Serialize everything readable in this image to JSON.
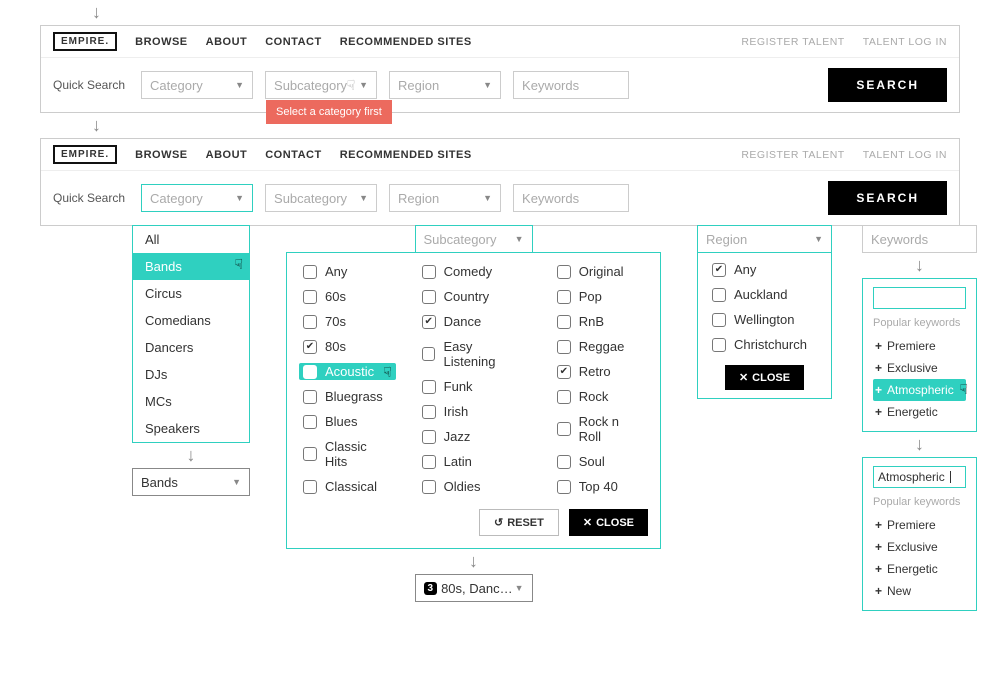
{
  "logo": "EMPIRE.",
  "nav": [
    "BROWSE",
    "ABOUT",
    "CONTACT",
    "RECOMMENDED SITES"
  ],
  "nav_right": [
    "REGISTER TALENT",
    "TALENT LOG IN"
  ],
  "quick_search_label": "Quick Search",
  "drops": {
    "category": "Category",
    "subcategory": "Subcategory",
    "region": "Region",
    "keywords": "Keywords"
  },
  "search_label": "SEARCH",
  "tooltip": "Select a category first",
  "categories": [
    "All",
    "Bands",
    "Circus",
    "Comedians",
    "Dancers",
    "DJs",
    "MCs",
    "Speakers"
  ],
  "category_selected": "Bands",
  "bands_label": "Bands",
  "sub_cols": [
    [
      {
        "label": "Any",
        "checked": false
      },
      {
        "label": "60s",
        "checked": false
      },
      {
        "label": "70s",
        "checked": false
      },
      {
        "label": "80s",
        "checked": true
      },
      {
        "label": "Acoustic",
        "checked": false,
        "highlight": true
      },
      {
        "label": "Bluegrass",
        "checked": false
      },
      {
        "label": "Blues",
        "checked": false
      },
      {
        "label": "Classic Hits",
        "checked": false
      },
      {
        "label": "Classical",
        "checked": false
      }
    ],
    [
      {
        "label": "Comedy",
        "checked": false
      },
      {
        "label": "Country",
        "checked": false
      },
      {
        "label": "Dance",
        "checked": true
      },
      {
        "label": "Easy Listening",
        "checked": false
      },
      {
        "label": "Funk",
        "checked": false
      },
      {
        "label": "Irish",
        "checked": false
      },
      {
        "label": "Jazz",
        "checked": false
      },
      {
        "label": "Latin",
        "checked": false
      },
      {
        "label": "Oldies",
        "checked": false
      }
    ],
    [
      {
        "label": "Original",
        "checked": false
      },
      {
        "label": "Pop",
        "checked": false
      },
      {
        "label": "RnB",
        "checked": false
      },
      {
        "label": "Reggae",
        "checked": false
      },
      {
        "label": "Retro",
        "checked": true
      },
      {
        "label": "Rock",
        "checked": false
      },
      {
        "label": "Rock n Roll",
        "checked": false
      },
      {
        "label": "Soul",
        "checked": false
      },
      {
        "label": "Top 40",
        "checked": false
      }
    ]
  ],
  "reset_label": "RESET",
  "close_label": "CLOSE",
  "sub_count": "3",
  "sub_summary": "80s, Danc…",
  "regions": [
    {
      "label": "Any",
      "checked": true
    },
    {
      "label": "Auckland",
      "checked": false
    },
    {
      "label": "Wellington",
      "checked": false
    },
    {
      "label": "Christchurch",
      "checked": false
    }
  ],
  "pk_label": "Popular keywords",
  "kw_panel1": {
    "items": [
      {
        "label": "Premiere"
      },
      {
        "label": "Exclusive"
      },
      {
        "label": "Atmospheric",
        "highlight": true
      },
      {
        "label": "Energetic"
      }
    ]
  },
  "kw_selected": "Atmospheric",
  "kw_panel2": {
    "items": [
      {
        "label": "Premiere"
      },
      {
        "label": "Exclusive"
      },
      {
        "label": "Energetic"
      },
      {
        "label": "New"
      }
    ]
  }
}
